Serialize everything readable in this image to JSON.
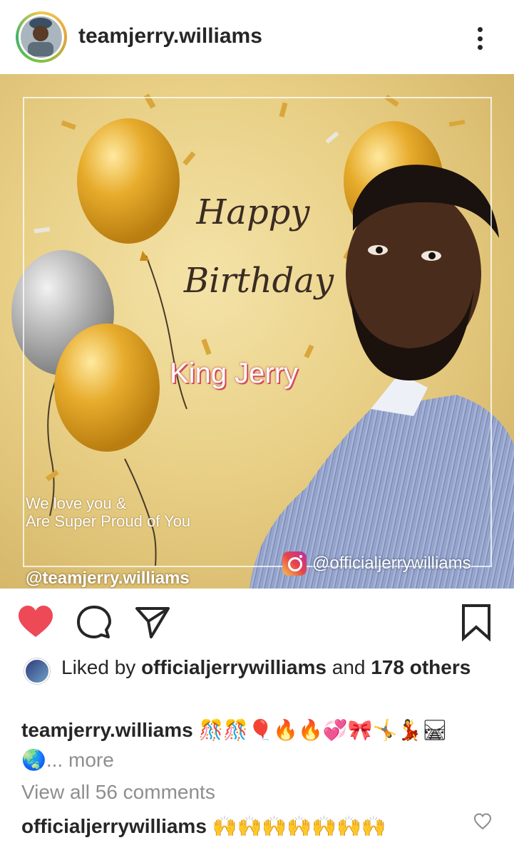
{
  "header": {
    "username": "teamjerry.williams"
  },
  "post_image": {
    "title_line1": "Happy",
    "title_line2": "Birthday",
    "name": "King Jerry",
    "message_line1": "We love you &",
    "message_line2": "Are Super Proud of You",
    "page_handle": "@teamjerry.williams",
    "ig_handle": "@officialjerrywilliams"
  },
  "actions": {
    "like_icon": "heart-filled-icon",
    "comment_icon": "comment-icon",
    "share_icon": "send-icon",
    "save_icon": "bookmark-icon",
    "like_color": "#ed4956"
  },
  "likes": {
    "prefix": "Liked by ",
    "user": "officialjerrywilliams",
    "middle": " and ",
    "others": "178 others"
  },
  "caption": {
    "username": "teamjerry.williams",
    "text": " 🎊🎊🎈🔥🔥💞🎀🤸💃🛤🌏",
    "more": "... more"
  },
  "view_all": "View all 56 comments",
  "comment": {
    "username": "officialjerrywilliams",
    "text": " 🙌🙌🙌🙌🙌🙌🙌"
  }
}
